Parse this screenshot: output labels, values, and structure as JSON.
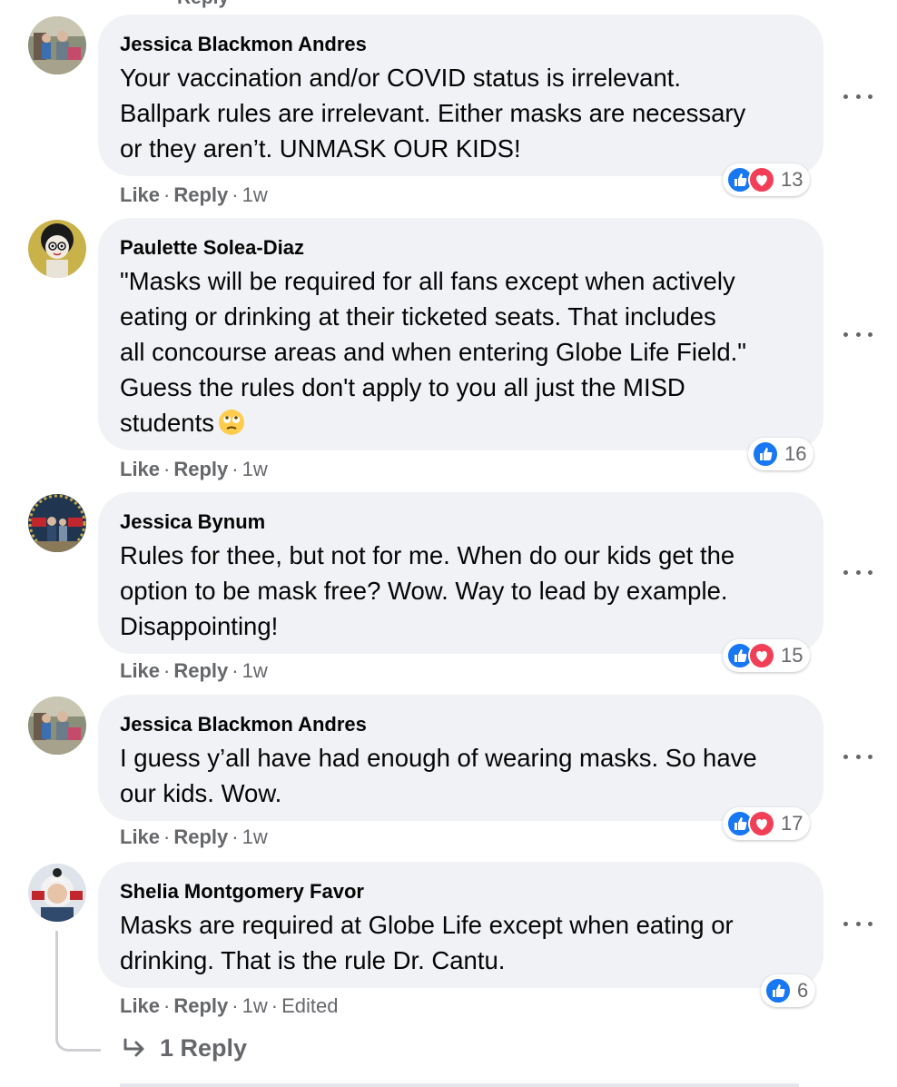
{
  "top_cut_text": "Reply",
  "actions": {
    "like_label": "Like",
    "reply_label": "Reply",
    "separator": "·"
  },
  "comments": [
    {
      "author": "Jessica Blackmon Andres",
      "text": "Your vaccination and/or COVID status is irrelevant.\nBallpark rules are irrelevant. Either masks are necessary\nor they aren’t. UNMASK OUR KIDS!",
      "time": "1w",
      "reactions": [
        "like",
        "love"
      ],
      "reaction_count": "13"
    },
    {
      "author": "Paulette Solea-Diaz",
      "text": "\"Masks will be required for all fans except when actively\neating or drinking at their ticketed seats. That includes\nall concourse areas and when entering Globe Life Field.\"\nGuess the rules don't apply to you all just the MISD\nstudents",
      "emoji": "face-with-rolling-eyes-emoji",
      "time": "1w",
      "reactions": [
        "like"
      ],
      "reaction_count": "16"
    },
    {
      "author": "Jessica Bynum",
      "text": "Rules for thee, but not for me. When do our kids get the\noption to be mask free? Wow. Way to lead by example.\nDisappointing!",
      "time": "1w",
      "reactions": [
        "like",
        "love"
      ],
      "reaction_count": "15"
    },
    {
      "author": "Jessica Blackmon Andres",
      "text": "I guess y’all have had enough of wearing masks. So have\nour kids. Wow.",
      "time": "1w",
      "reactions": [
        "like",
        "love"
      ],
      "reaction_count": "17"
    },
    {
      "author": "Shelia Montgomery Favor",
      "text": "Masks are required at Globe Life except when eating or\ndrinking. That is the rule Dr. Cantu.",
      "time": "1w",
      "edited_label": "Edited",
      "reactions": [
        "like"
      ],
      "reaction_count": "6"
    }
  ],
  "replies_link": "1 Reply",
  "icons": {
    "more": "more-options-icon",
    "like": "like-reaction-icon",
    "love": "love-reaction-icon",
    "reply_arrow": "reply-arrow-icon"
  },
  "colors": {
    "bubble": "#f0f2f5",
    "secondary_text": "#65676b",
    "like_blue": "#1877f2",
    "love_red": "#f33e58"
  }
}
